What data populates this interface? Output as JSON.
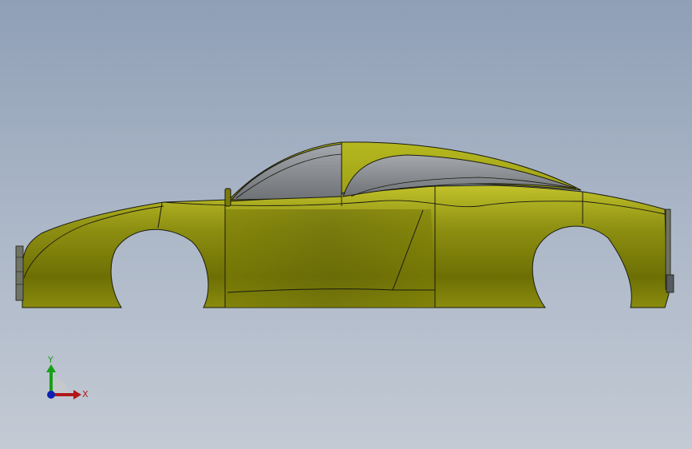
{
  "viewport": {
    "background_top": "#8f9fb6",
    "background_bottom": "#c3cad4"
  },
  "model": {
    "body_color": "#9ea019",
    "body_shadow_color": "#6f7003",
    "glass_color": "#8a8e92",
    "edge_color": "#1a1a10"
  },
  "triad": {
    "x_label": "X",
    "y_label": "Y",
    "x_color": "#b01818",
    "y_color": "#17a017",
    "z_color": "#1020b0"
  }
}
